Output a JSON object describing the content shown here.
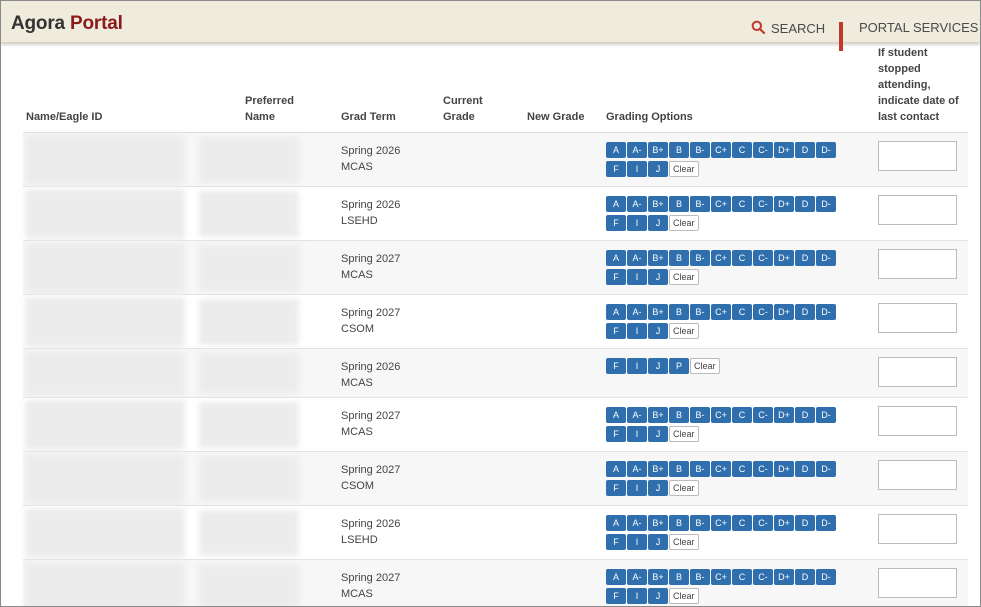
{
  "header": {
    "logo_word1": "Agora",
    "logo_word2": "Portal",
    "search_label": "SEARCH",
    "portal_services_label": "PORTAL SERVICES",
    "accent_color": "#8b1a1a",
    "icon_color": "#c0392b"
  },
  "table": {
    "columns": {
      "name": "Name/Eagle ID",
      "preferred": "Preferred Name",
      "grad_term": "Grad Term",
      "current_grade": "Current Grade",
      "new_grade": "New Grade",
      "grading_options": "Grading Options",
      "last_contact": "If student stopped attending, indicate date of last contact"
    },
    "clear_label": "Clear",
    "grade_button_color": "#2f6fad",
    "rows": [
      {
        "term_line1": "Spring 2026",
        "term_line2": "MCAS",
        "options": [
          "A",
          "A-",
          "B+",
          "B",
          "B-",
          "C+",
          "C",
          "C-",
          "D+",
          "D",
          "D-",
          "F",
          "I",
          "J"
        ]
      },
      {
        "term_line1": "Spring 2026",
        "term_line2": "LSEHD",
        "options": [
          "A",
          "A-",
          "B+",
          "B",
          "B-",
          "C+",
          "C",
          "C-",
          "D+",
          "D",
          "D-",
          "F",
          "I",
          "J"
        ]
      },
      {
        "term_line1": "Spring 2027",
        "term_line2": "MCAS",
        "options": [
          "A",
          "A-",
          "B+",
          "B",
          "B-",
          "C+",
          "C",
          "C-",
          "D+",
          "D",
          "D-",
          "F",
          "I",
          "J"
        ]
      },
      {
        "term_line1": "Spring 2027",
        "term_line2": "CSOM",
        "options": [
          "A",
          "A-",
          "B+",
          "B",
          "B-",
          "C+",
          "C",
          "C-",
          "D+",
          "D",
          "D-",
          "F",
          "I",
          "J"
        ]
      },
      {
        "term_line1": "Spring 2026",
        "term_line2": "MCAS",
        "options": [
          "F",
          "I",
          "J",
          "P"
        ]
      },
      {
        "term_line1": "Spring 2027",
        "term_line2": "MCAS",
        "options": [
          "A",
          "A-",
          "B+",
          "B",
          "B-",
          "C+",
          "C",
          "C-",
          "D+",
          "D",
          "D-",
          "F",
          "I",
          "J"
        ]
      },
      {
        "term_line1": "Spring 2027",
        "term_line2": "CSOM",
        "options": [
          "A",
          "A-",
          "B+",
          "B",
          "B-",
          "C+",
          "C",
          "C-",
          "D+",
          "D",
          "D-",
          "F",
          "I",
          "J"
        ]
      },
      {
        "term_line1": "Spring 2026",
        "term_line2": "LSEHD",
        "options": [
          "A",
          "A-",
          "B+",
          "B",
          "B-",
          "C+",
          "C",
          "C-",
          "D+",
          "D",
          "D-",
          "F",
          "I",
          "J"
        ]
      },
      {
        "term_line1": "Spring 2027",
        "term_line2": "MCAS",
        "options": [
          "A",
          "A-",
          "B+",
          "B",
          "B-",
          "C+",
          "C",
          "C-",
          "D+",
          "D",
          "D-",
          "F",
          "I",
          "J"
        ]
      }
    ]
  }
}
